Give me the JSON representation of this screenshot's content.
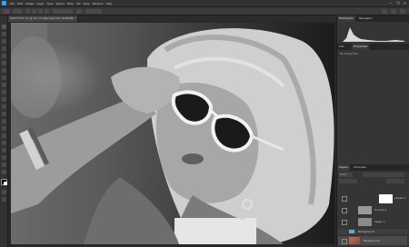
{
  "menubar": {
    "items": [
      "File",
      "Edit",
      "Image",
      "Layer",
      "Type",
      "Select",
      "Filter",
      "3D",
      "View",
      "Window",
      "Help"
    ],
    "controls": [
      "—",
      "❐",
      "✕"
    ]
  },
  "document": {
    "tab_title": "DSCF7437 (1) @ 61.7% (Background, RGB/8#) *"
  },
  "panels": {
    "top_tabs": [
      "Histogram",
      "Navigator"
    ],
    "properties_tabs": [
      "Info",
      "Properties"
    ],
    "properties_text": "No Properties",
    "layers_tabs": [
      "Layers",
      "Channels"
    ],
    "layers_filter": "Kind",
    "layers": [
      {
        "name": "Levels 1"
      },
      {
        "name": "Curves 1"
      },
      {
        "name": "Layer 1"
      },
      {
        "name": "Background"
      }
    ],
    "group_name": "Background"
  },
  "colors": {
    "accent": "#31a8ff",
    "panel": "#353535",
    "selected_layer": "#4b4b4b"
  }
}
